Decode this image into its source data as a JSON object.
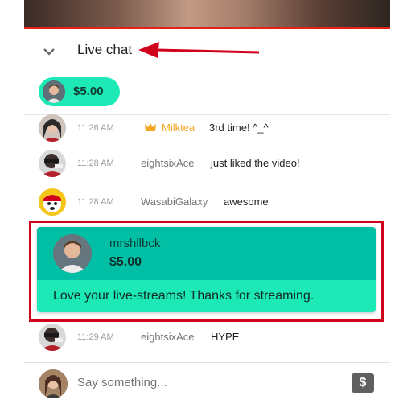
{
  "header": {
    "title": "Live chat"
  },
  "ticker": {
    "amount": "$5.00"
  },
  "messages": [
    {
      "time": "11:26 AM",
      "author": "Milktea",
      "text": "3rd time! ^_^",
      "author_color": "#f5a623",
      "badge": "crown-icon"
    },
    {
      "time": "11:28 AM",
      "author": "eightsixAce",
      "text": "just liked the video!"
    },
    {
      "time": "11:28 AM",
      "author": "WasabiGalaxy",
      "text": "awesome"
    },
    {
      "time": "11:29 AM",
      "author": "eightsixAce",
      "text": "HYPE"
    }
  ],
  "superchat": {
    "author": "mrshllbck",
    "amount": "$5.00",
    "text": "Love your live-streams! Thanks for streaming."
  },
  "input": {
    "placeholder": "Say something..."
  },
  "colors": {
    "accent_red": "#e62117",
    "highlight_outline": "#d0021b",
    "superchat_dark": "#00bfa5",
    "superchat_light": "#1de9b6"
  }
}
